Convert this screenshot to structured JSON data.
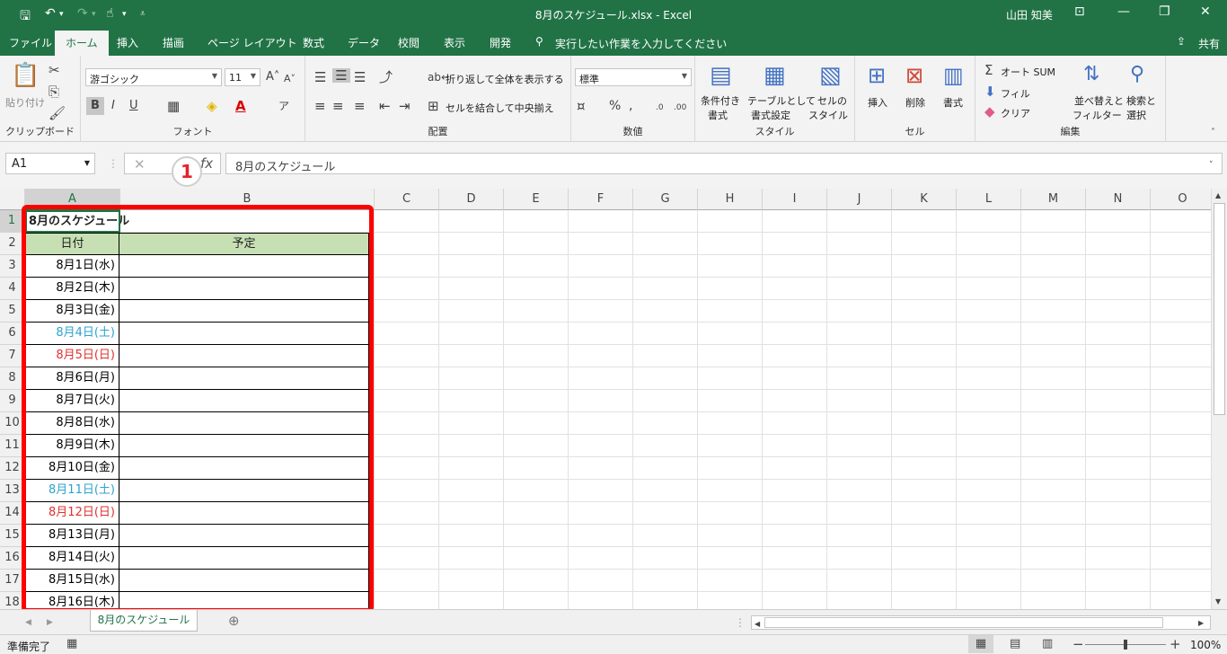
{
  "titlebar": {
    "title": "8月のスケジュール.xlsx  -  Excel",
    "user": "山田 知美"
  },
  "tabs": [
    "ファイル",
    "ホーム",
    "挿入",
    "描画",
    "ページ レイアウト",
    "数式",
    "データ",
    "校閲",
    "表示",
    "開発"
  ],
  "tellme": "実行したい作業を入力してください",
  "share": "共有",
  "ribbon": {
    "paste": "貼り付け",
    "clipboard": "クリップボード",
    "font_name": "游ゴシック",
    "font_size": "11",
    "font": "フォント",
    "wrap": "折り返して全体を表示する",
    "merge": "セルを結合して中央揃え",
    "align": "配置",
    "number_format": "標準",
    "number": "数値",
    "cond": "条件付き",
    "cond2": "書式",
    "table": "テーブルとして",
    "table2": "書式設定",
    "cellstyle": "セルの",
    "cellstyle2": "スタイル",
    "style": "スタイル",
    "insert": "挿入",
    "delete": "削除",
    "format": "書式",
    "cells": "セル",
    "autosum": "オート SUM",
    "fill": "フィル",
    "clear": "クリア",
    "sort": "並べ替えと",
    "sort2": "フィルター",
    "find": "検索と",
    "find2": "選択",
    "edit": "編集"
  },
  "namebox": "A1",
  "formula": "8月のスケジュール",
  "badge": "1",
  "columns": [
    "A",
    "B",
    "C",
    "D",
    "E",
    "F",
    "G",
    "H",
    "I",
    "J",
    "K",
    "L",
    "M",
    "N",
    "O"
  ],
  "rows": [
    "1",
    "2",
    "3",
    "4",
    "5",
    "6",
    "7",
    "8",
    "9",
    "10",
    "11",
    "12",
    "13",
    "14",
    "15",
    "16",
    "17",
    "18"
  ],
  "sheet": {
    "title": "8月のスケジュール",
    "header_date": "日付",
    "header_plan": "予定",
    "dates": [
      {
        "text": "8月1日(水)",
        "color": "#000000"
      },
      {
        "text": "8月2日(木)",
        "color": "#000000"
      },
      {
        "text": "8月3日(金)",
        "color": "#000000"
      },
      {
        "text": "8月4日(土)",
        "color": "#2ea2cf"
      },
      {
        "text": "8月5日(日)",
        "color": "#e0312f"
      },
      {
        "text": "8月6日(月)",
        "color": "#000000"
      },
      {
        "text": "8月7日(火)",
        "color": "#000000"
      },
      {
        "text": "8月8日(水)",
        "color": "#000000"
      },
      {
        "text": "8月9日(木)",
        "color": "#000000"
      },
      {
        "text": "8月10日(金)",
        "color": "#000000"
      },
      {
        "text": "8月11日(土)",
        "color": "#2ea2cf"
      },
      {
        "text": "8月12日(日)",
        "color": "#e0312f"
      },
      {
        "text": "8月13日(月)",
        "color": "#000000"
      },
      {
        "text": "8月14日(火)",
        "color": "#000000"
      },
      {
        "text": "8月15日(水)",
        "color": "#000000"
      },
      {
        "text": "8月16日(木)",
        "color": "#000000"
      }
    ]
  },
  "sheet_tab": "8月のスケジュール",
  "status": "準備完了",
  "zoom": "100%",
  "colors": {
    "excel_green": "#217346",
    "header_fill": "#c6e0b4",
    "highlight": "#ff0000"
  }
}
